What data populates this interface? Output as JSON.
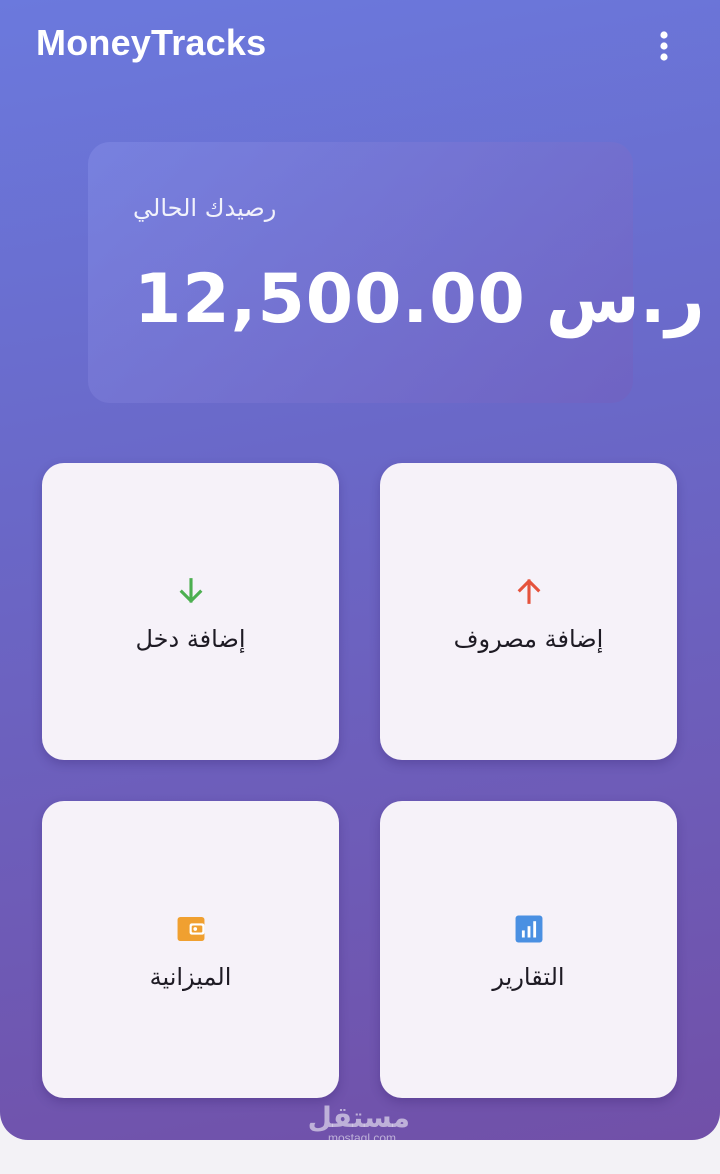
{
  "app": {
    "title": "MoneyTracks",
    "menu_icon": "more-vert-icon"
  },
  "balance": {
    "label": "رصيدك الحالي",
    "amount": "12,500.00",
    "currency": "ر.س"
  },
  "actions": [
    {
      "id": "income",
      "label": "إضافة دخل",
      "icon": "arrow-down-icon",
      "color": "#4caf50"
    },
    {
      "id": "expense",
      "label": "إضافة مصروف",
      "icon": "arrow-up-icon",
      "color": "#e5533d"
    },
    {
      "id": "budget",
      "label": "الميزانية",
      "icon": "wallet-icon",
      "color": "#f0a030"
    },
    {
      "id": "reports",
      "label": "التقارير",
      "icon": "bar-chart-icon",
      "color": "#4a90e2"
    }
  ],
  "watermark": {
    "arabic": "مستقل",
    "latin": "mostaql.com"
  },
  "colors": {
    "gradient_start": "#6b79dd",
    "gradient_end": "#7150a8",
    "card_bg": "#f6f2f9"
  }
}
